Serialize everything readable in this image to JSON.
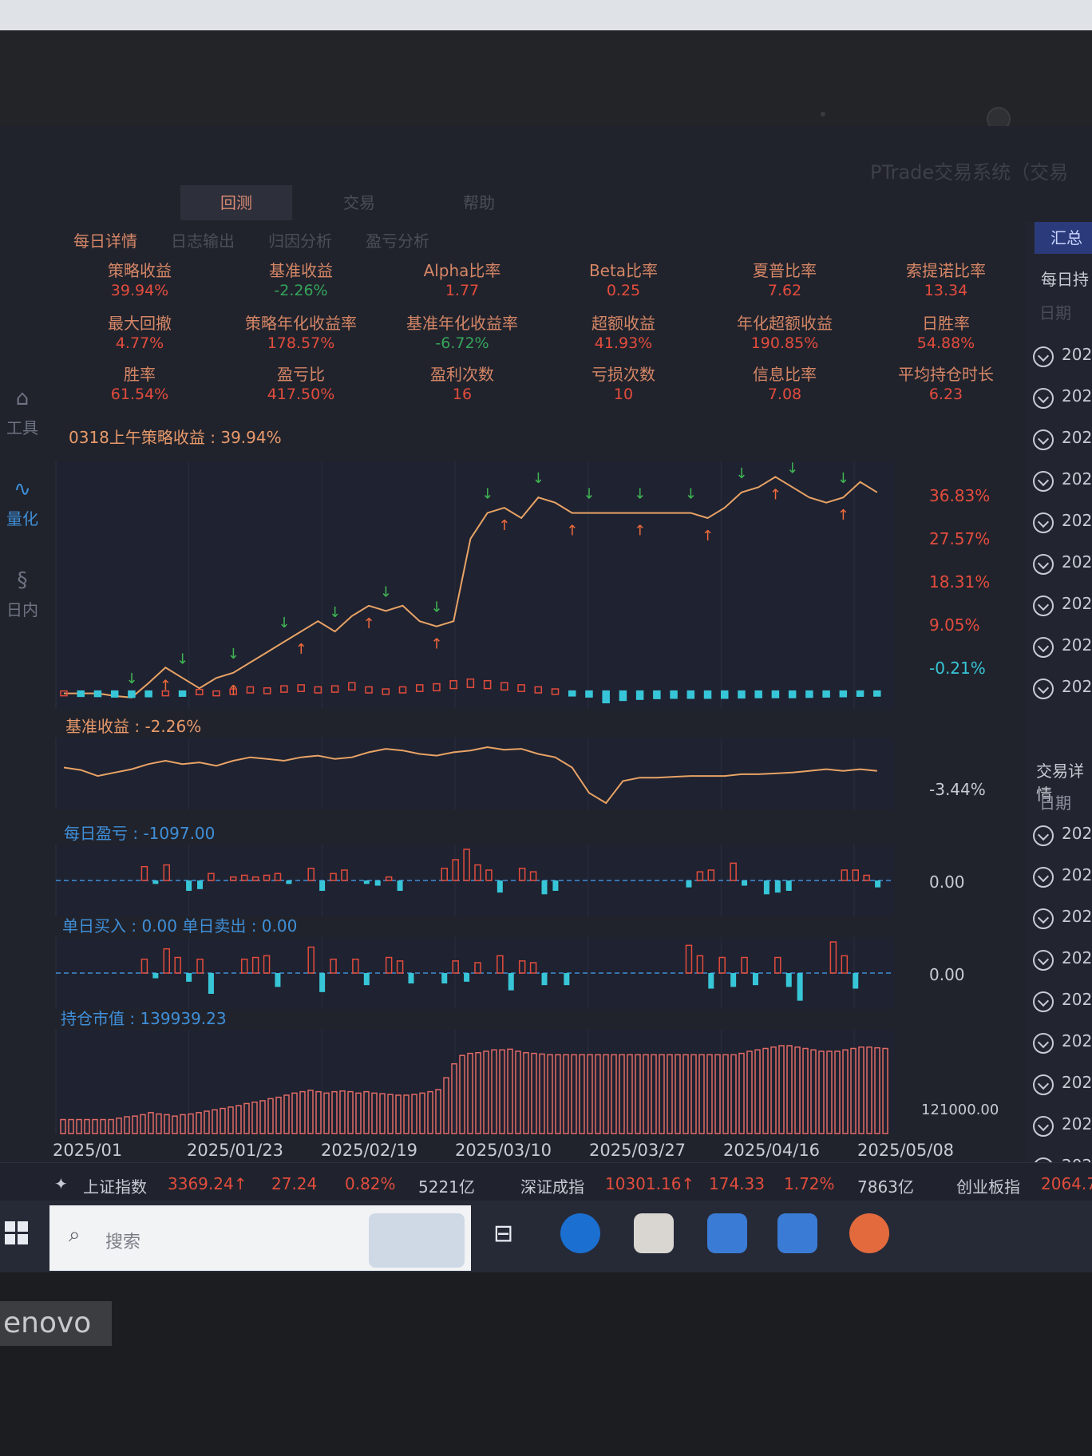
{
  "window": {
    "title": "PTrade交易系统（交易"
  },
  "top_tabs": [
    {
      "label": "回测"
    },
    {
      "label": "交易"
    },
    {
      "label": "帮助"
    }
  ],
  "sub_tabs": [
    {
      "label": "每日详情"
    },
    {
      "label": "日志输出"
    },
    {
      "label": "归因分析"
    },
    {
      "label": "盈亏分析"
    }
  ],
  "sidebar": [
    {
      "label": "工具",
      "icon": "toolbox-icon"
    },
    {
      "label": "量化",
      "icon": "pulse-icon"
    },
    {
      "label": "日内",
      "icon": "intraday-icon"
    }
  ],
  "metrics": [
    {
      "label": "策略收益",
      "value": "39.94%",
      "color": "red"
    },
    {
      "label": "基准收益",
      "value": "-2.26%",
      "color": "green"
    },
    {
      "label": "Alpha比率",
      "value": "1.77",
      "color": "red"
    },
    {
      "label": "Beta比率",
      "value": "0.25",
      "color": "red"
    },
    {
      "label": "夏普比率",
      "value": "7.62",
      "color": "red"
    },
    {
      "label": "索提诺比率",
      "value": "13.34",
      "color": "red"
    },
    {
      "label": "最大回撤",
      "value": "4.77%",
      "color": "red"
    },
    {
      "label": "策略年化收益率",
      "value": "178.57%",
      "color": "red"
    },
    {
      "label": "基准年化收益率",
      "value": "-6.72%",
      "color": "green"
    },
    {
      "label": "超额收益",
      "value": "41.93%",
      "color": "red"
    },
    {
      "label": "年化超额收益",
      "value": "190.85%",
      "color": "red"
    },
    {
      "label": "日胜率",
      "value": "54.88%",
      "color": "red"
    },
    {
      "label": "胜率",
      "value": "61.54%",
      "color": "red"
    },
    {
      "label": "盈亏比",
      "value": "417.50%",
      "color": "red"
    },
    {
      "label": "盈利次数",
      "value": "16",
      "color": "red"
    },
    {
      "label": "亏损次数",
      "value": "10",
      "color": "red"
    },
    {
      "label": "信息比率",
      "value": "7.08",
      "color": "red"
    },
    {
      "label": "平均持仓时长",
      "value": "6.23",
      "color": "red"
    }
  ],
  "panels": {
    "strategy_title": "0318上午策略收益 : 39.94%",
    "benchmark_title": "基准收益 : -2.26%",
    "daily_pnl_title": "每日盈亏 : -1097.00",
    "daily_trade_title": "单日买入 : 0.00  单日卖出 : 0.00",
    "position_title": "持仓市值 : 139939.23"
  },
  "right_panel": {
    "tab_label": "汇总",
    "section_label": "每日持",
    "header": "日期",
    "trade_section": "交易详情",
    "trade_header": "日期",
    "row_text": "202"
  },
  "ticker": {
    "items": [
      {
        "name": "上证指数",
        "price": "3369.24↑",
        "change": "27.24",
        "pct": "0.82%",
        "volume": "5221亿"
      },
      {
        "name": "深证成指",
        "price": "10301.16↑",
        "change": "174.33",
        "pct": "1.72%",
        "volume": "7863亿"
      },
      {
        "name": "创业板指",
        "price": "2064.7"
      }
    ]
  },
  "taskbar": {
    "search_placeholder": "搜索"
  },
  "chart_data": [
    {
      "type": "line",
      "title": "0318上午策略收益 : 39.94%",
      "y_tick_labels": [
        "36.83%",
        "27.57%",
        "18.31%",
        "9.05%",
        "-0.21%"
      ],
      "ylim": [
        -3.0,
        45.0
      ],
      "x_tick_labels": [
        "2025/01",
        "2025/01/23",
        "2025/02/19",
        "2025/03/10",
        "2025/03/27",
        "2025/04/16",
        "2025/05/08"
      ],
      "series": [
        {
          "values": [
            0,
            0,
            0,
            -0.5,
            -0.8,
            2,
            5,
            3,
            1,
            3,
            4,
            6,
            8,
            10,
            12,
            14,
            12,
            15,
            17,
            16,
            17,
            14,
            13,
            14,
            30,
            35,
            36,
            34,
            38,
            37,
            35,
            35,
            35,
            35,
            35,
            35,
            35,
            35,
            34,
            36,
            39,
            40,
            42,
            40,
            38,
            37,
            38,
            41,
            39
          ]
        },
        {
          "values": [
            0,
            -0.4,
            -0.5,
            -0.8,
            -1.0,
            -0.6,
            0.0,
            -0.3,
            0.3,
            0.0,
            0.4,
            0.8,
            0.6,
            1.0,
            1.2,
            0.8,
            1.0,
            1.6,
            0.8,
            0.4,
            0.8,
            1.2,
            1.4,
            2.0,
            2.3,
            2.0,
            1.6,
            1.2,
            0.8,
            0.4,
            -0.1,
            -0.8,
            -4.5,
            -3.0,
            -2.3,
            -1.8,
            -1.6,
            -1.6,
            -1.6,
            -1.6,
            -1.4,
            -1.2,
            -1.2,
            -1.2,
            -1.0,
            -0.8,
            -0.6,
            -0.3,
            -0.2
          ]
        }
      ]
    },
    {
      "type": "line",
      "title": "基准收益 : -2.26%",
      "y_tick_labels": [
        "-3.44%"
      ],
      "values": [
        0,
        -0.3,
        -1.0,
        -0.6,
        -0.2,
        0.4,
        0.8,
        0.4,
        0.6,
        0.2,
        0.8,
        1.2,
        1.0,
        0.8,
        1.2,
        1.4,
        1.0,
        1.2,
        1.8,
        2.2,
        2.0,
        1.6,
        1.4,
        1.8,
        2.0,
        2.4,
        2.1,
        2.2,
        1.6,
        1.2,
        0.0,
        -3.0,
        -4.2,
        -1.6,
        -1.2,
        -1.2,
        -1.1,
        -1.0,
        -1.0,
        -1.0,
        -0.8,
        -0.8,
        -0.7,
        -0.6,
        -0.4,
        -0.2,
        -0.4,
        -0.2,
        -0.4
      ]
    },
    {
      "type": "bar",
      "title": "每日盈亏 : -1097.00",
      "y_tick_labels": [
        "0.00"
      ],
      "values": [
        0,
        0,
        0,
        0,
        0,
        0,
        0,
        800,
        -200,
        900,
        0,
        -600,
        -500,
        400,
        0,
        200,
        300,
        200,
        300,
        400,
        -200,
        0,
        700,
        -600,
        400,
        600,
        0,
        -200,
        -300,
        200,
        -600,
        0,
        0,
        0,
        700,
        1200,
        1800,
        900,
        600,
        -700,
        0,
        700,
        500,
        -800,
        -600,
        0,
        0,
        0,
        0,
        0,
        0,
        0,
        0,
        0,
        0,
        0,
        -400,
        500,
        600,
        0,
        1000,
        -300,
        0,
        -800,
        -700,
        -600,
        0,
        0,
        0,
        0,
        600,
        600,
        300,
        -400
      ]
    },
    {
      "type": "bar",
      "title": "单日买入 : 0.00  单日卖出 : 0.00",
      "y_tick_labels": [
        "0.00"
      ],
      "values": [
        0,
        0,
        0,
        0,
        0,
        0,
        0,
        800,
        -300,
        1400,
        900,
        -500,
        800,
        -1200,
        0,
        0,
        800,
        900,
        1000,
        -800,
        0,
        0,
        1500,
        -1100,
        800,
        0,
        800,
        -700,
        0,
        900,
        700,
        -600,
        0,
        0,
        -600,
        700,
        -500,
        600,
        0,
        1000,
        -1000,
        700,
        600,
        -700,
        0,
        -700,
        0,
        0,
        0,
        0,
        0,
        0,
        0,
        0,
        0,
        0,
        1600,
        1000,
        -900,
        900,
        -800,
        900,
        -700,
        0,
        900,
        -800,
        -1600,
        0,
        0,
        1800,
        1000,
        -900,
        0,
        0
      ]
    },
    {
      "type": "bar",
      "title": "持仓市值 : 139939.23",
      "y_tick_labels": [
        "121000.00"
      ],
      "values": [
        20,
        20,
        20,
        20,
        20,
        20,
        20,
        22,
        24,
        25,
        27,
        30,
        28,
        27,
        25,
        27,
        28,
        30,
        32,
        34,
        36,
        38,
        40,
        43,
        45,
        47,
        50,
        52,
        55,
        58,
        60,
        62,
        60,
        58,
        60,
        61,
        60,
        58,
        60,
        58,
        57,
        56,
        55,
        55,
        56,
        58,
        60,
        63,
        80,
        100,
        112,
        115,
        116,
        118,
        120,
        120,
        121,
        118,
        116,
        115,
        114,
        113,
        113,
        113,
        113,
        113,
        113,
        113,
        113,
        113,
        113,
        113,
        113,
        113,
        113,
        113,
        113,
        113,
        113,
        113,
        113,
        113,
        113,
        113,
        113,
        115,
        118,
        120,
        122,
        124,
        126,
        126,
        124,
        122,
        120,
        118,
        118,
        118,
        120,
        122,
        124,
        124,
        123,
        122
      ]
    }
  ]
}
